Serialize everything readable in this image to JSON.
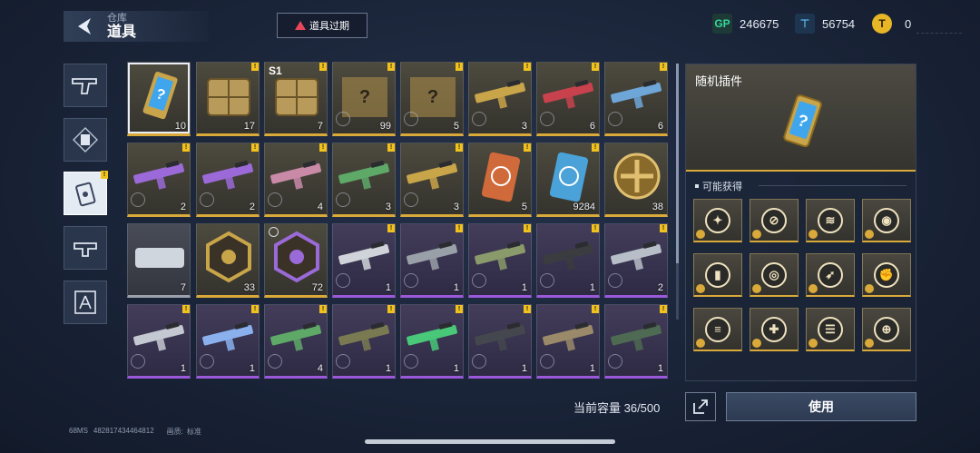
{
  "header": {
    "breadcrumb_sub": "仓库",
    "breadcrumb_main": "道具",
    "expired_button": "道具过期"
  },
  "currencies": [
    {
      "icon": "gp-icon",
      "label": "GP",
      "value": "246675"
    },
    {
      "icon": "ticket-icon",
      "label": "",
      "value": "56754"
    },
    {
      "icon": "gold-coin-icon",
      "label": "",
      "value": "0"
    }
  ],
  "tabs": [
    {
      "icon": "pistol-icon",
      "active": false
    },
    {
      "icon": "card-icon",
      "active": false
    },
    {
      "icon": "chip-icon",
      "active": true
    },
    {
      "icon": "attachment-icon",
      "active": false
    },
    {
      "icon": "blueprint-icon",
      "active": false
    }
  ],
  "items": [
    {
      "name": "random-plugin-card",
      "qty": "10",
      "rarity": "gold",
      "selected": true
    },
    {
      "name": "supply-crate",
      "qty": "17",
      "rarity": "gold",
      "new": true
    },
    {
      "name": "s1-crate",
      "qty": "7",
      "rarity": "gold",
      "tag": "S1",
      "new": true
    },
    {
      "name": "mystery-rifle-blueprint",
      "qty": "99",
      "rarity": "gold",
      "new": true
    },
    {
      "name": "mystery-sniper-blueprint",
      "qty": "5",
      "rarity": "gold",
      "new": true
    },
    {
      "name": "gold-smg-skin",
      "qty": "3",
      "rarity": "gold",
      "new": true
    },
    {
      "name": "red-rifle-skin",
      "qty": "6",
      "rarity": "gold",
      "new": true
    },
    {
      "name": "blue-pistol-skin",
      "qty": "6",
      "rarity": "gold",
      "new": true
    },
    {
      "name": "purple-shotgun-skin",
      "qty": "2",
      "rarity": "gold",
      "new": true
    },
    {
      "name": "purple-rifle-skin",
      "qty": "2",
      "rarity": "gold",
      "new": true
    },
    {
      "name": "pink-rifle-skin",
      "qty": "4",
      "rarity": "gold",
      "new": true
    },
    {
      "name": "green-rifle-skin",
      "qty": "3",
      "rarity": "gold",
      "new": true
    },
    {
      "name": "gold-rifle-skin",
      "qty": "3",
      "rarity": "gold",
      "new": true
    },
    {
      "name": "red-badge-card",
      "qty": "5",
      "rarity": "gold",
      "new": true
    },
    {
      "name": "blue-chip-card",
      "qty": "9284",
      "rarity": "gold",
      "new": true
    },
    {
      "name": "gold-cross-medal",
      "qty": "38",
      "rarity": "gold"
    },
    {
      "name": "silver-module",
      "qty": "7",
      "rarity": "grey"
    },
    {
      "name": "gold-hex-emblem",
      "qty": "33",
      "rarity": "gold"
    },
    {
      "name": "purple-star-emblem",
      "qty": "72",
      "rarity": "gold",
      "clock": true
    },
    {
      "name": "white-pistol-skin",
      "qty": "1",
      "rarity": "purple",
      "new": true
    },
    {
      "name": "grey-rifle-skin",
      "qty": "1",
      "rarity": "purple",
      "new": true
    },
    {
      "name": "camo-rifle-skin",
      "qty": "1",
      "rarity": "purple",
      "new": true
    },
    {
      "name": "black-rifle-skin",
      "qty": "1",
      "rarity": "purple",
      "new": true
    },
    {
      "name": "chrome-rifle-skin",
      "qty": "2",
      "rarity": "purple",
      "new": true
    },
    {
      "name": "silver-pistol-skin",
      "qty": "1",
      "rarity": "purple",
      "new": true
    },
    {
      "name": "electric-rifle-skin",
      "qty": "1",
      "rarity": "purple",
      "new": true
    },
    {
      "name": "green-smg-skin",
      "qty": "4",
      "rarity": "purple",
      "new": true
    },
    {
      "name": "olive-shotgun-skin",
      "qty": "1",
      "rarity": "purple",
      "new": true
    },
    {
      "name": "neon-rifle-skin",
      "qty": "1",
      "rarity": "purple",
      "new": true
    },
    {
      "name": "dark-smg-skin",
      "qty": "1",
      "rarity": "purple",
      "new": true
    },
    {
      "name": "tan-rifle-skin",
      "qty": "1",
      "rarity": "purple",
      "new": true
    },
    {
      "name": "forest-rifle-skin",
      "qty": "1",
      "rarity": "purple",
      "new": true
    }
  ],
  "detail": {
    "title": "随机插件",
    "may_obtain_label": "可能获得",
    "rewards": [
      "wings-plugin-icon",
      "scope-plugin-icon",
      "claw-plugin-icon",
      "helmet-plugin-icon",
      "ammo-plugin-icon",
      "target-plugin-icon",
      "bullets-plugin-icon",
      "fist-plugin-icon",
      "magazine-plugin-icon",
      "shield-plugin-icon",
      "rack-plugin-icon",
      "aim-plugin-icon"
    ]
  },
  "footer": {
    "capacity": "当前容量 36/500",
    "use_button": "使用",
    "fps_label": "68MS",
    "player_id": "482817434464812",
    "quality_label": "画质:",
    "quality_value": "标准"
  },
  "colors": {
    "gold": "#d9a93a",
    "purple": "#9b59d9",
    "grey": "#9aa1ad",
    "warning": "#e6485a",
    "new_badge": "#f2c21c"
  }
}
